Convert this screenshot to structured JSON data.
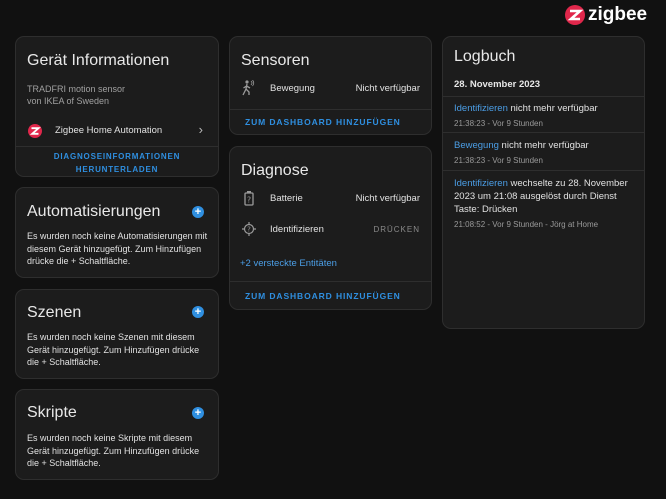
{
  "brand": {
    "name": "zigbee",
    "accent": "#e0274b"
  },
  "device_info": {
    "title": "Gerät Informationen",
    "model": "TRADFRI motion sensor",
    "manufacturer": "von IKEA of Sweden",
    "integration": "Zigbee Home Automation",
    "download_line1": "DIAGNOSEINFORMATIONEN",
    "download_line2": "HERUNTERLADEN"
  },
  "automations": {
    "title": "Automatisierungen",
    "text": "Es wurden noch keine Automatisierungen mit diesem Gerät hinzugefügt. Zum Hinzufügen drücke die + Schaltfläche."
  },
  "scenes": {
    "title": "Szenen",
    "text": "Es wurden noch keine Szenen mit diesem Gerät hinzugefügt. Zum Hinzufügen drücke die + Schaltfläche."
  },
  "scripts": {
    "title": "Skripte",
    "text": "Es wurden noch keine Skripte mit diesem Gerät hinzugefügt. Zum Hinzufügen drücke die + Schaltfläche."
  },
  "sensors": {
    "title": "Sensoren",
    "rows": [
      {
        "label": "Bewegung",
        "value": "Nicht verfügbar",
        "icon": "motion-icon"
      }
    ],
    "add_label": "ZUM DASHBOARD HINZUFÜGEN"
  },
  "diagnostics": {
    "title": "Diagnose",
    "battery_label": "Batterie",
    "battery_value": "Nicht verfügbar",
    "identify_label": "Identifizieren",
    "identify_button": "DRÜCKEN",
    "hidden_entities": "+2 versteckte Entitäten",
    "add_label": "ZUM DASHBOARD HINZUFÜGEN"
  },
  "logbook": {
    "title": "Logbuch",
    "date": "28. November 2023",
    "entries": [
      {
        "entity": "Identifizieren",
        "message": " nicht mehr verfügbar",
        "meta": "21:38:23 - Vor 9 Stunden"
      },
      {
        "entity": "Bewegung",
        "message": " nicht mehr verfügbar",
        "meta": "21:38:23 - Vor 9 Stunden"
      },
      {
        "entity": "Identifizieren",
        "message": " wechselte zu 28. November 2023 um 21:08 ausgelöst durch Dienst Taste: Drücken",
        "meta": "21:08:52 - Vor 9 Stunden - Jörg at Home"
      }
    ]
  }
}
